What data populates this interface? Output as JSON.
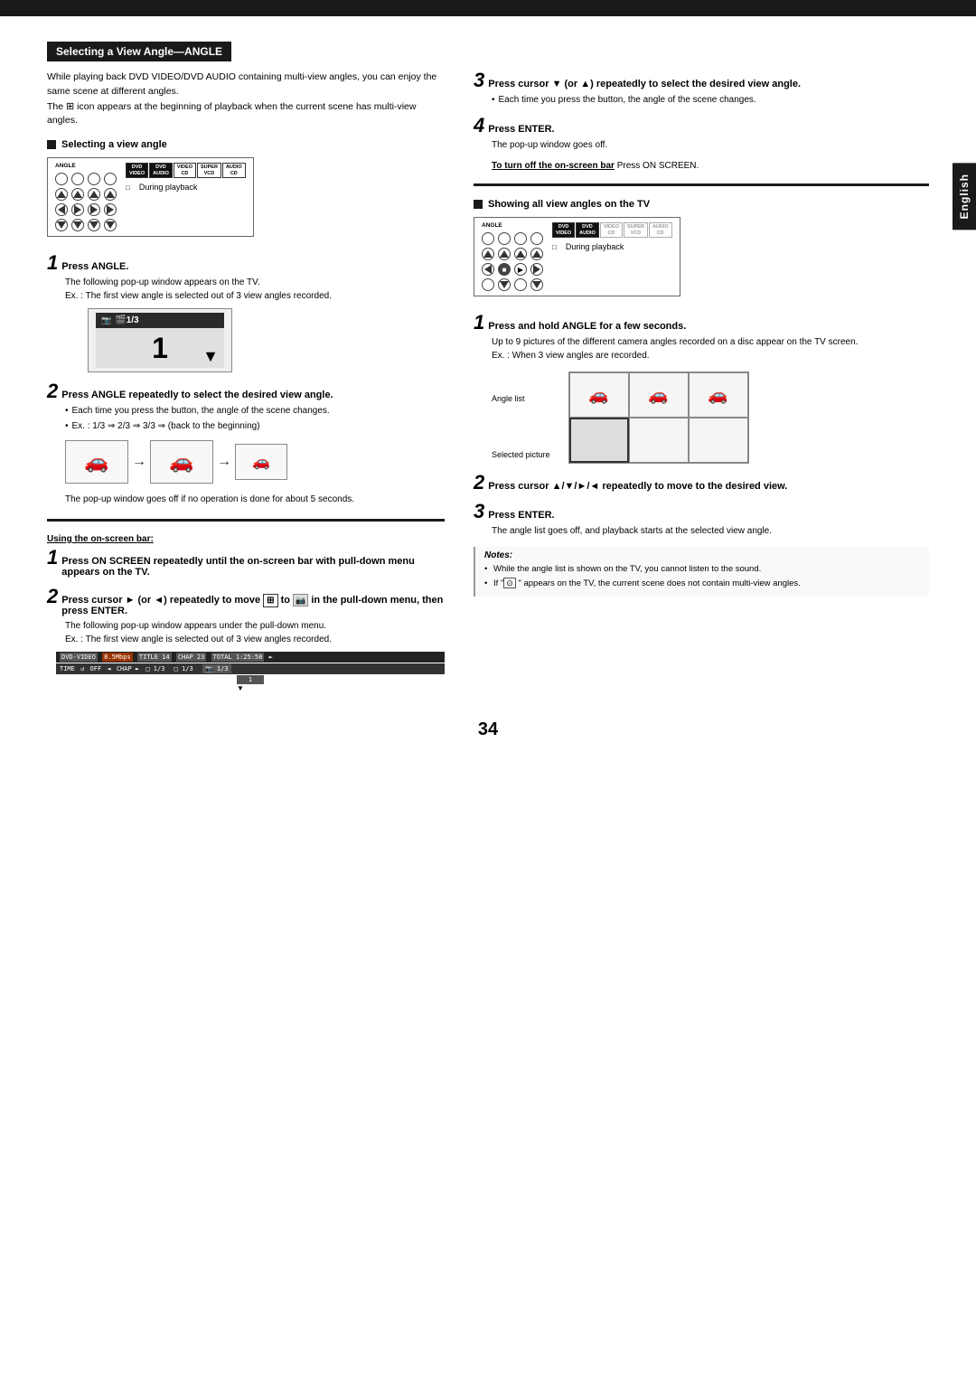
{
  "page": {
    "top_bar_visible": true,
    "english_tab": "English",
    "page_number": "34"
  },
  "section_title": "Selecting a View Angle—ANGLE",
  "intro": "While playing back DVD VIDEO/DVD AUDIO containing multi-view angles, you can enjoy the same scene at different angles.\nThe  icon appears at the beginning of playback when the current scene has multi-view angles.",
  "left_col": {
    "sub_heading": "Selecting a view angle",
    "during_playback": "During playback",
    "step1": {
      "num": "1",
      "title": "Press ANGLE.",
      "body": "The following pop-up window appears on the TV.",
      "note": "Ex. : The first view angle is selected out of 3 view angles recorded."
    },
    "step2": {
      "num": "2",
      "title": "Press ANGLE repeatedly to select the desired view angle.",
      "bullets": [
        "Each time you press the button, the angle of the scene changes.",
        "Ex. : 1/3 ⇒ 2/3 ⇒ 3/3 ⇒ (back to the beginning)"
      ]
    },
    "popup_note": "The pop-up window goes off if no operation is done for about 5 seconds.",
    "using_onscreen_label": "Using the on-screen bar:",
    "step_onscreen_1": {
      "num": "1",
      "title": "Press ON SCREEN repeatedly until the on-screen bar with pull-down menu appears on the TV."
    },
    "step_onscreen_2": {
      "num": "2",
      "title": "Press cursor ► (or ◄) repeatedly to move  to  in the pull-down menu, then press ENTER.",
      "body": "The following pop-up window appears under the pull-down menu.",
      "note": "Ex. : The first view angle is selected out of 3 view angles recorded."
    },
    "onscreen_bar": {
      "row1": "DVD-VIDEO  8.5Mbps   TITLE 14  CHAP 23  TOTAL 1:25:58  ►",
      "row2": "TIME ↺ OFF  ◄  CHAP ►   1/3   1/3   1/3"
    }
  },
  "right_col": {
    "step3": {
      "num": "3",
      "title": "Press cursor ▼ (or ▲) repeatedly to select the desired view angle.",
      "bullets": [
        "Each time you press the button, the angle of the scene changes."
      ]
    },
    "step4": {
      "num": "4",
      "title": "Press ENTER.",
      "body": "The pop-up window goes off."
    },
    "turn_off_label": "To turn off the on-screen bar",
    "turn_off_body": "Press ON SCREEN.",
    "sub_heading2": "Showing all view angles on the TV",
    "during_playback2": "During playback",
    "step_r1": {
      "num": "1",
      "title": "Press and hold ANGLE for a few seconds.",
      "body": "Up to 9 pictures of the different camera angles recorded on a disc appear on the TV screen.",
      "note": "Ex. : When 3 view angles are recorded."
    },
    "angle_list_label": "Angle list",
    "selected_picture_label": "Selected picture",
    "step_r2": {
      "num": "2",
      "title": "Press cursor ▲/▼/►/◄ repeatedly to move  to the desired view."
    },
    "step_r3": {
      "num": "3",
      "title": "Press ENTER.",
      "body": "The angle list goes off, and playback starts at the selected view angle."
    },
    "notes_title": "Notes:",
    "notes": [
      "While the angle list is shown on the TV, you cannot listen to the sound.",
      "If \"  \" appears on the TV, the current scene does not contain multi-view angles."
    ]
  }
}
